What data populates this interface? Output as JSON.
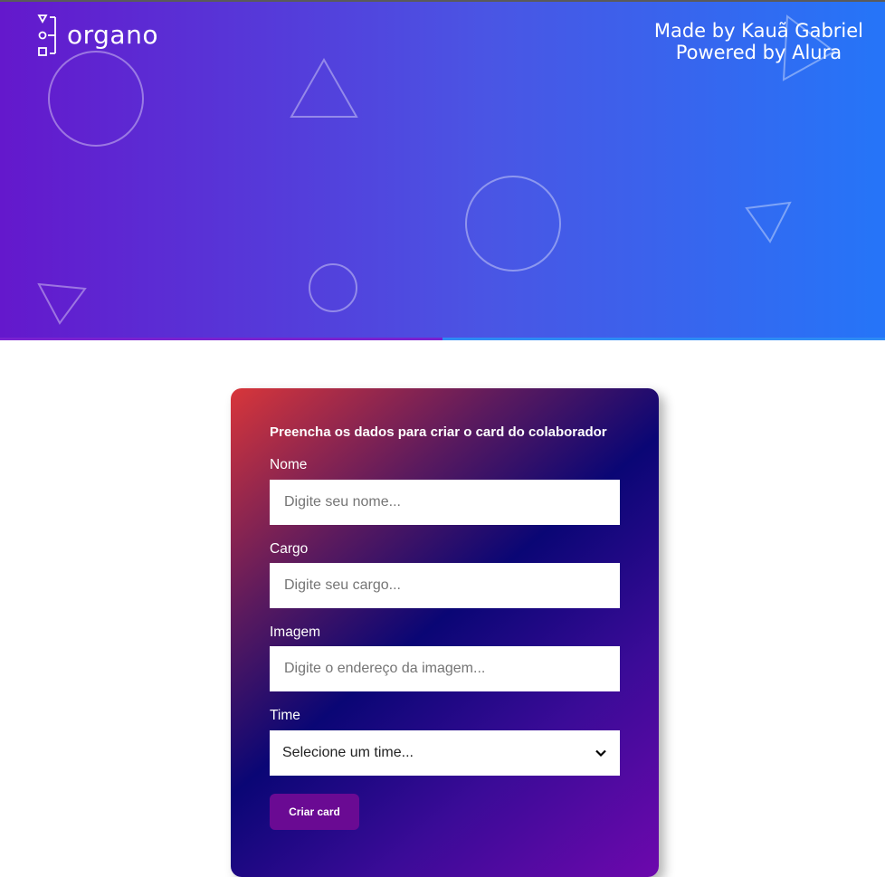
{
  "header": {
    "logo_text": "organo",
    "credit_line1": "Made by Kauã Gabriel",
    "credit_line2": "Powered by Alura",
    "gradient_start": "#6418cc",
    "gradient_end": "#2575f8"
  },
  "form": {
    "title": "Preencha os dados para criar o card do colaborador",
    "fields": [
      {
        "label": "Nome",
        "placeholder": "Digite seu nome..."
      },
      {
        "label": "Cargo",
        "placeholder": "Digite seu cargo..."
      },
      {
        "label": "Imagem",
        "placeholder": "Digite o endereço da imagem..."
      }
    ],
    "time": {
      "label": "Time",
      "selected": "Selecione um time..."
    },
    "submit_label": "Criar card",
    "button_color": "#6a0a93"
  }
}
